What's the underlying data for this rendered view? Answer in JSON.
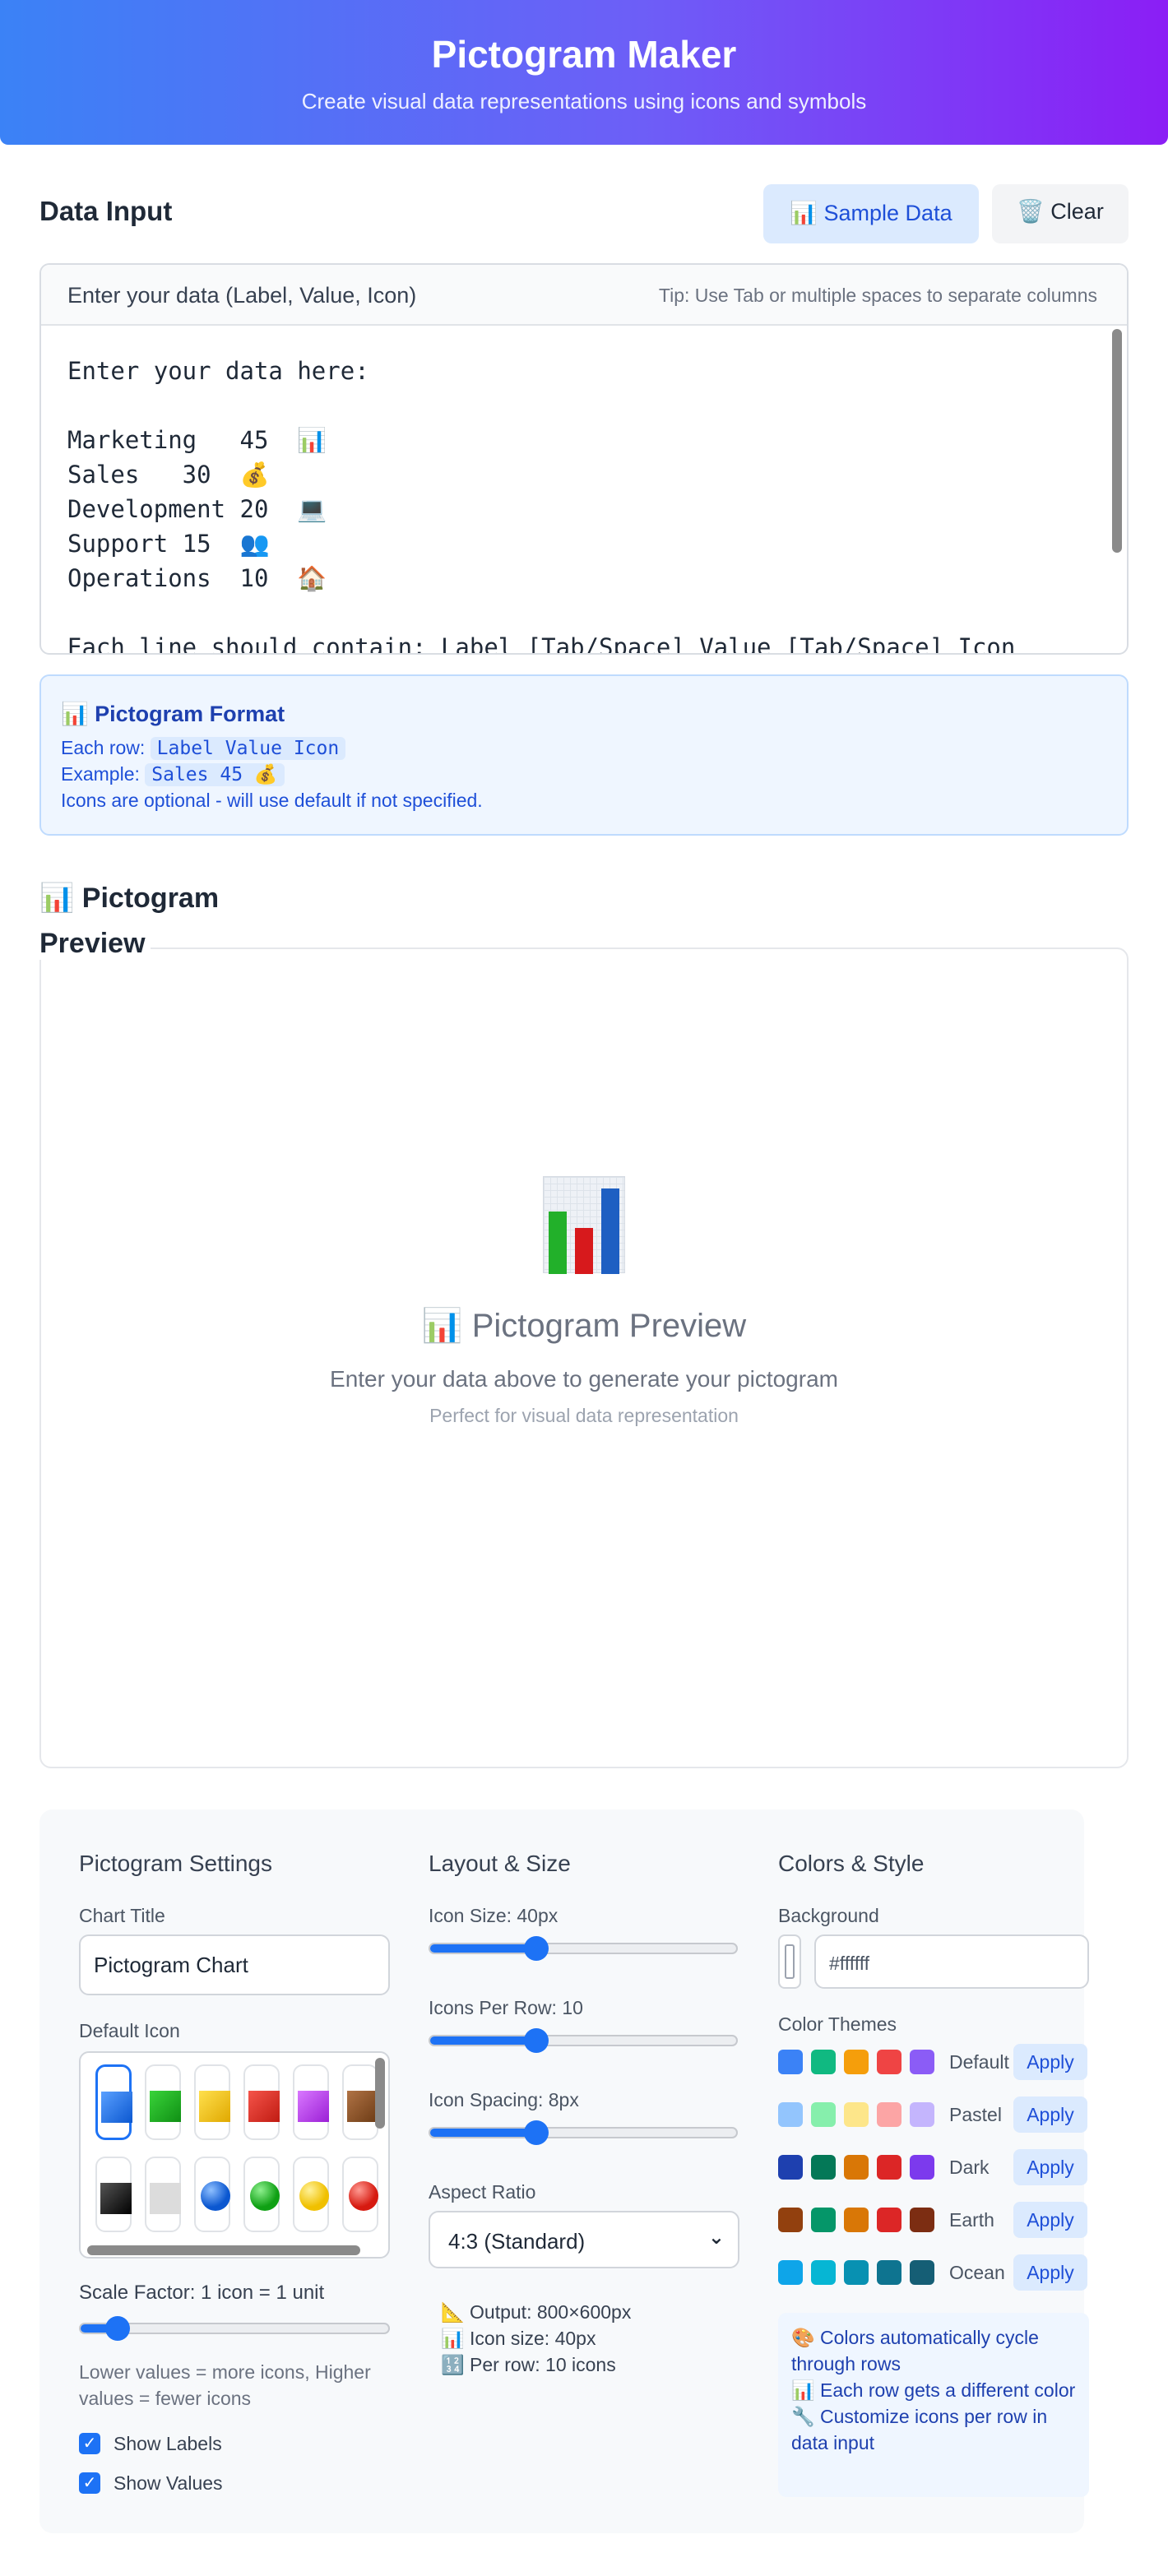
{
  "header": {
    "title": "Pictogram Maker",
    "subtitle": "Create visual data representations using icons and symbols"
  },
  "data_input": {
    "title": "Data Input",
    "sample_button": "📊 Sample Data",
    "clear_button": "🗑️ Clear",
    "editor_label": "Enter your data (Label, Value, Icon)",
    "editor_tip": "Tip: Use Tab or multiple spaces to separate columns",
    "editor_text": "Enter your data here:\n\nMarketing   45  📊\nSales   30  💰\nDevelopment 20  💻\nSupport 15  👥\nOperations  10  🏠\n\nEach line should contain: Label [Tab/Space] Value [Tab/Space] Icon"
  },
  "format_help": {
    "title": "📊 Pictogram Format",
    "row_prefix": "Each row:",
    "row_code": "Label Value Icon",
    "example_prefix": "Example:",
    "example_code": "Sales 45 💰",
    "note": "Icons are optional - will use default if not specified."
  },
  "preview": {
    "heading_icon": "📊",
    "heading_line1": "Pictogram",
    "heading_line2": "Preview",
    "placeholder_title": "📊 Pictogram Preview",
    "placeholder_subtitle": "Enter your data above to generate your pictogram",
    "placeholder_note": "Perfect for visual data representation"
  },
  "settings": {
    "pictogram": {
      "title": "Pictogram Settings",
      "chart_title_label": "Chart Title",
      "chart_title_value": "Pictogram Chart",
      "default_icon_label": "Default Icon",
      "icons_row1": [
        "blue-square-icon",
        "green-square-icon",
        "yellow-square-icon",
        "red-square-icon",
        "purple-square-icon",
        "brown-square-icon"
      ],
      "icons_row2": [
        "black-square-icon",
        "white-square-icon",
        "blue-circle-icon",
        "green-circle-icon",
        "yellow-circle-icon",
        "red-circle-icon"
      ],
      "scale_label": "Scale Factor: 1 icon = 1 unit",
      "scale_value": 1,
      "scale_hint": "Lower values = more icons, Higher values = fewer icons",
      "show_labels": "Show Labels",
      "show_values": "Show Values"
    },
    "layout": {
      "title": "Layout & Size",
      "icon_size_label": "Icon Size: 40px",
      "icon_size_value": 40,
      "per_row_label": "Icons Per Row: 10",
      "per_row_value": 10,
      "spacing_label": "Icon Spacing: 8px",
      "spacing_value": 8,
      "aspect_label": "Aspect Ratio",
      "aspect_value": "4:3 (Standard)",
      "info": [
        "📐 Output: 800×600px",
        "📊 Icon size: 40px",
        "🔢 Per row: 10 icons"
      ]
    },
    "colors": {
      "title": "Colors & Style",
      "background_label": "Background",
      "background_value": "#ffffff",
      "themes_label": "Color Themes",
      "apply_label": "Apply",
      "themes": [
        {
          "name": "Default",
          "colors": [
            "#3b82f6",
            "#10b981",
            "#f59e0b",
            "#ef4444",
            "#8b5cf6"
          ]
        },
        {
          "name": "Pastel",
          "colors": [
            "#93c5fd",
            "#86efac",
            "#fde68a",
            "#fca5a5",
            "#c4b5fd"
          ]
        },
        {
          "name": "Dark",
          "colors": [
            "#1e40af",
            "#047857",
            "#d97706",
            "#dc2626",
            "#7c3aed"
          ]
        },
        {
          "name": "Earth",
          "colors": [
            "#92400e",
            "#059669",
            "#d97706",
            "#dc2626",
            "#7c2d12"
          ]
        },
        {
          "name": "Ocean",
          "colors": [
            "#0ea5e9",
            "#06b6d4",
            "#0891b2",
            "#0e7490",
            "#155e75"
          ]
        }
      ],
      "tips": [
        "🎨 Colors automatically cycle through rows",
        "📊 Each row gets a different color",
        "🔧 Customize icons per row in data input"
      ]
    }
  }
}
